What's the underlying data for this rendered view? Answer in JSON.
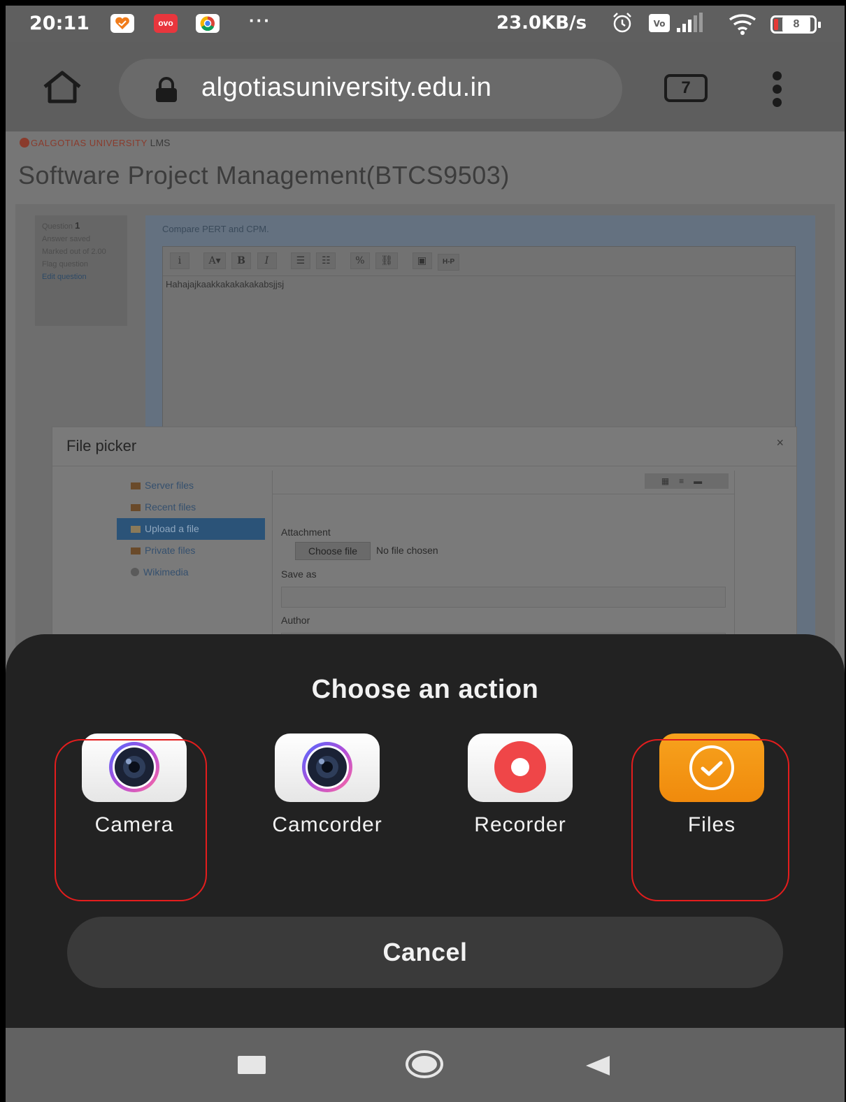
{
  "status_bar": {
    "time": "20:11",
    "app_icons": [
      "heart-app-icon",
      "oyo-app-icon",
      "chrome-app-icon"
    ],
    "oyo_text": "ovo",
    "more": "···",
    "net_speed": "23.0KB/s",
    "battery": "8"
  },
  "browser": {
    "url": "algotiasuniversity.edu.in",
    "tab_count": "7"
  },
  "page": {
    "logo_brand": "GALGOTIAS UNIVERSITY",
    "logo_suffix": "LMS",
    "course_title": "Software Project Management(BTCS9503)",
    "question_info": {
      "label": "Question",
      "number": "1",
      "status": "Answer saved",
      "marks": "Marked out of 2.00",
      "flag": "Flag question",
      "edit": "Edit question"
    },
    "question_text": "Compare PERT and CPM.",
    "editor_toolbar": [
      "i",
      "A▾",
      "B",
      "I",
      "☰",
      "☷",
      "%",
      "⛓",
      "▣",
      "H-P"
    ],
    "answer_text": "Hahajajkaakkakakakakabsjjsj"
  },
  "file_picker": {
    "title": "File picker",
    "close": "×",
    "repositories": [
      {
        "label": "Server files",
        "active": false
      },
      {
        "label": "Recent files",
        "active": false
      },
      {
        "label": "Upload a file",
        "active": true
      },
      {
        "label": "Private files",
        "active": false
      },
      {
        "label": "Wikimedia",
        "active": false
      }
    ],
    "view_icons": "▦≡▬",
    "attachment_label": "Attachment",
    "choose_file": "Choose file",
    "no_file": "No file chosen",
    "save_as_label": "Save as",
    "author_label": "Author"
  },
  "action_sheet": {
    "title": "Choose an action",
    "options": [
      {
        "label": "Camera",
        "icon": "camera-icon"
      },
      {
        "label": "Camcorder",
        "icon": "camcorder-icon"
      },
      {
        "label": "Recorder",
        "icon": "recorder-icon"
      },
      {
        "label": "Files",
        "icon": "files-icon"
      }
    ],
    "cancel": "Cancel",
    "highlight_color": "#e41d1d"
  },
  "colors": {
    "status_bar": "#5f5f5f",
    "sheet_bg": "#222222",
    "files_accent": "#f39514",
    "recorder_accent": "#ef4648"
  }
}
